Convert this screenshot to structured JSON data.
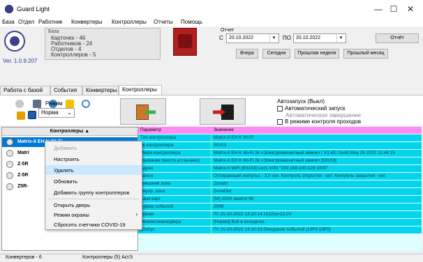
{
  "window": {
    "title": "Guard Light",
    "minimize": "—",
    "maximize": "☐",
    "close": "✕"
  },
  "menu": [
    "База",
    "Отдел",
    "Работник",
    "Конвертеры",
    "Контроллеры",
    "Отчеты",
    "Помощь"
  ],
  "header": {
    "version": "Ver. 1.0.9.207",
    "stats_title": "База",
    "stats": [
      "Карточек - 46",
      "Работников - 24",
      "Отделов - 4",
      "Контроллеров - 5"
    ]
  },
  "report": {
    "group_label": "Отчет",
    "from_label": "С",
    "from_date": "20.10.2022",
    "to_label": "ПО",
    "to_date": "20.10.2022",
    "report_button": "Отчёт",
    "quick": [
      "Вчера",
      "Сегодня",
      "Прошлая неделя",
      "Прошлый месяц"
    ]
  },
  "tabs": [
    "Работа с базой",
    "События",
    "Конвертеры",
    "Контроллеры"
  ],
  "active_tab": 3,
  "toolbar": {
    "mode_label": "Режим",
    "mode_value": "Норма",
    "autostart_title": "Автозапуск (Выкл)",
    "autostart_options": [
      "Автоматический запуск",
      "Автоматическое завершение",
      "В режиме контроля проходов"
    ]
  },
  "tree": {
    "header": "Контроллеры ▲",
    "rows": [
      "Matrix-II EH K Wi-Fi",
      "Matri",
      "Z-5R",
      "Z-5R",
      "Z5R-"
    ]
  },
  "grid": {
    "col1": "Параметр",
    "col2": "Значение",
    "rows": [
      [
        "Тип контроллера",
        "Matrix-II EH K Wi-Fi"
      ],
      [
        "№ контроллера",
        "50103"
      ],
      [
        "Инфо контроллера",
        "Matrix-II EH K Wi-Fi 2k <Электромагнитный замок> / V2.43 / build May 25 2022 11:44:15"
      ],
      [
        "Название (место установки)",
        "Matrix-II EH K Wi-Fi 2k <Электромагнитный замок> [50103]"
      ],
      [
        "Адрес",
        "Matrix-II WiFi [50103] Lic(1:100) \"192.168.100.128:1000\""
      ],
      [
        "Замок",
        "Отпирающий импульс - 3.0 сек. Контроль открытия - нет. Контроль закрытия - нет."
      ],
      [
        "Внешняя зона",
        "ZonaIn"
      ],
      [
        "Внутр. зона",
        "ZonaOut"
      ],
      [
        "Банк карт",
        "[W] 2024 занято 46"
      ],
      [
        "Буфер событий",
        "2048"
      ],
      [
        "Время",
        "Пт 21-10-2022 13:10:14 U(12v)=12,0V"
      ],
      [
        "Режим/замок/дверь",
        "[Норма] Всё в исходном"
      ],
      [
        "Статус",
        "Пт 21-10-2022 13:10:13 Ожидание событий (13F0 13F0)"
      ]
    ]
  },
  "context_menu": {
    "items": [
      "Добавить",
      "Настроить",
      "Удалить",
      "Обновить",
      "Добавить группу контроллеров",
      "Открыть дверь",
      "Режим охраны",
      "Сбросить счетчики COVID-19"
    ],
    "submenu_arrow": "›"
  },
  "status": {
    "converters": "Конвертеров - 6",
    "controllers": "Контроллеры (5) Act:5"
  }
}
